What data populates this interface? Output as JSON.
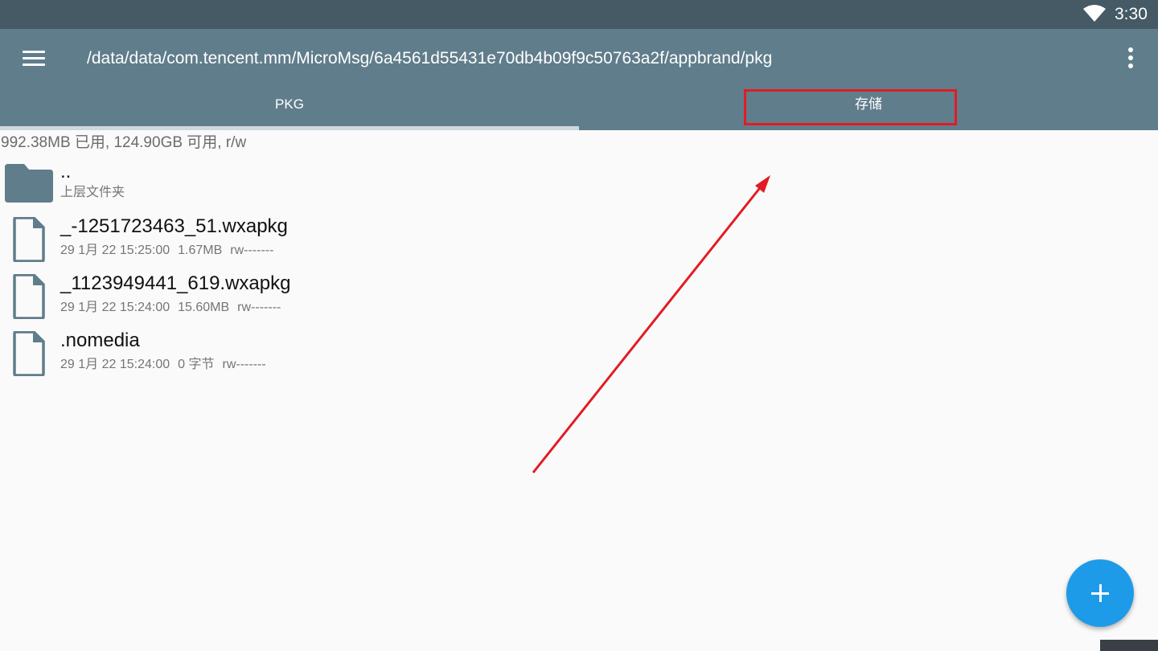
{
  "status_bar": {
    "time": "3:30",
    "icons": [
      "wifi-icon"
    ]
  },
  "toolbar": {
    "menu_icon": "menu-icon",
    "path": "/data/data/com.tencent.mm/MicroMsg/6a4561d55431e70db4b09f9c50763a2f/appbrand/pkg",
    "more_icon": "more-vert-icon"
  },
  "tabs": [
    {
      "label": "PKG",
      "selected": true
    },
    {
      "label": "存储",
      "selected": false
    }
  ],
  "storage_info": "992.38MB 已用, 124.90GB 可用, r/w",
  "files": [
    {
      "icon": "folder-icon",
      "name": "..",
      "subtitle": "上层文件夹"
    },
    {
      "icon": "file-icon",
      "name": "_-1251723463_51.wxapkg",
      "date": "29 1月 22 15:25:00",
      "size": "1.67MB",
      "perms": "rw-------"
    },
    {
      "icon": "file-icon",
      "name": "_1123949441_619.wxapkg",
      "date": "29 1月 22 15:24:00",
      "size": "15.60MB",
      "perms": "rw-------"
    },
    {
      "icon": "file-icon",
      "name": ".nomedia",
      "date": "29 1月 22 15:24:00",
      "size": "0 字节",
      "perms": "rw-------"
    }
  ],
  "fab": {
    "icon": "plus-icon"
  },
  "colors": {
    "status_bar": "#455a64",
    "toolbar": "#607d8b",
    "fab": "#1e9be8",
    "annotation": "#e21b23"
  }
}
